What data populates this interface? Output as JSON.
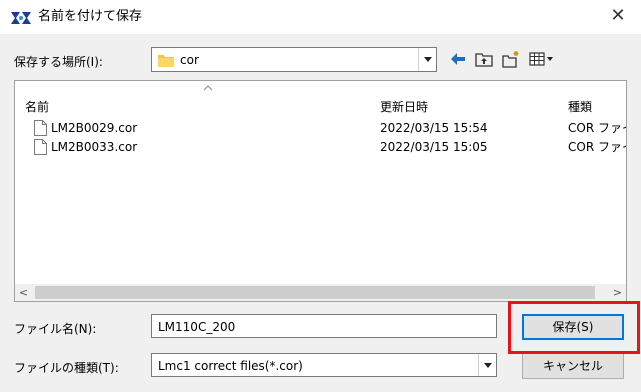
{
  "window": {
    "title": "名前を付けて保存",
    "close_glyph": "✕"
  },
  "location": {
    "label": "保存する場所(I):",
    "value": "cor",
    "toolbar_icons": [
      "back-arrow-icon",
      "up-folder-icon",
      "new-folder-icon",
      "view-menu-icon"
    ]
  },
  "file_list": {
    "columns": [
      "名前",
      "更新日時",
      "種類"
    ],
    "rows": [
      {
        "name": "LM2B0029.cor",
        "modified": "2022/03/15 15:54",
        "type": "COR ファイ"
      },
      {
        "name": "LM2B0033.cor",
        "modified": "2022/03/15 15:05",
        "type": "COR ファイ"
      }
    ],
    "scroll_left": "<",
    "scroll_right": ">"
  },
  "filename": {
    "label": "ファイル名(N):",
    "value": "LM110C_200"
  },
  "filetype": {
    "label": "ファイルの種類(T):",
    "value": "Lmc1 correct files(*.cor)"
  },
  "buttons": {
    "save": "保存(S)",
    "cancel": "キャンセル"
  },
  "colors": {
    "accent": "#0078d7",
    "highlight": "#e8141b",
    "folder": "#f4c63d"
  }
}
